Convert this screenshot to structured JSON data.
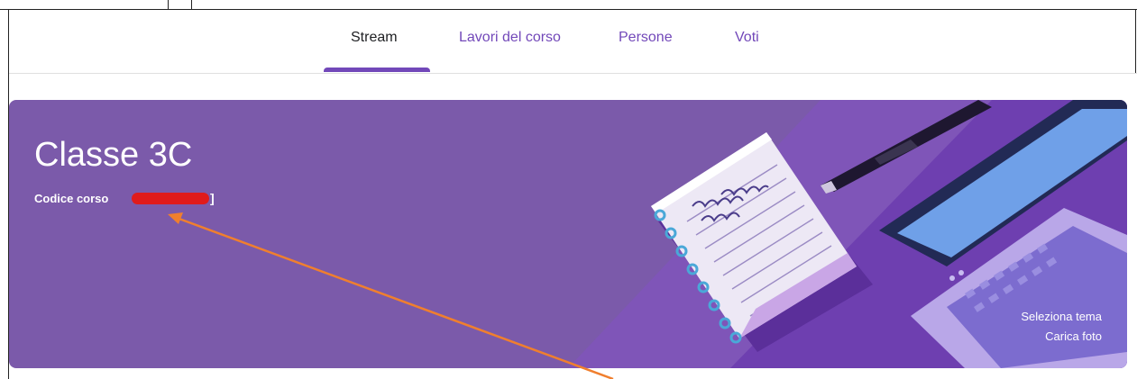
{
  "tabs": [
    {
      "label": "Stream",
      "active": true
    },
    {
      "label": "Lavori del corso",
      "active": false
    },
    {
      "label": "Persone",
      "active": false
    },
    {
      "label": "Voti",
      "active": false
    }
  ],
  "banner": {
    "title": "Classe 3C",
    "code_label": "Codice corso",
    "code_value_visible": "]",
    "select_theme": "Seleziona tema",
    "upload_photo": "Carica foto"
  },
  "colors": {
    "accent": "#7248b9",
    "banner_bg": "#7b5aaa",
    "redaction": "#e01b1b",
    "arrow": "#f07f2e"
  }
}
